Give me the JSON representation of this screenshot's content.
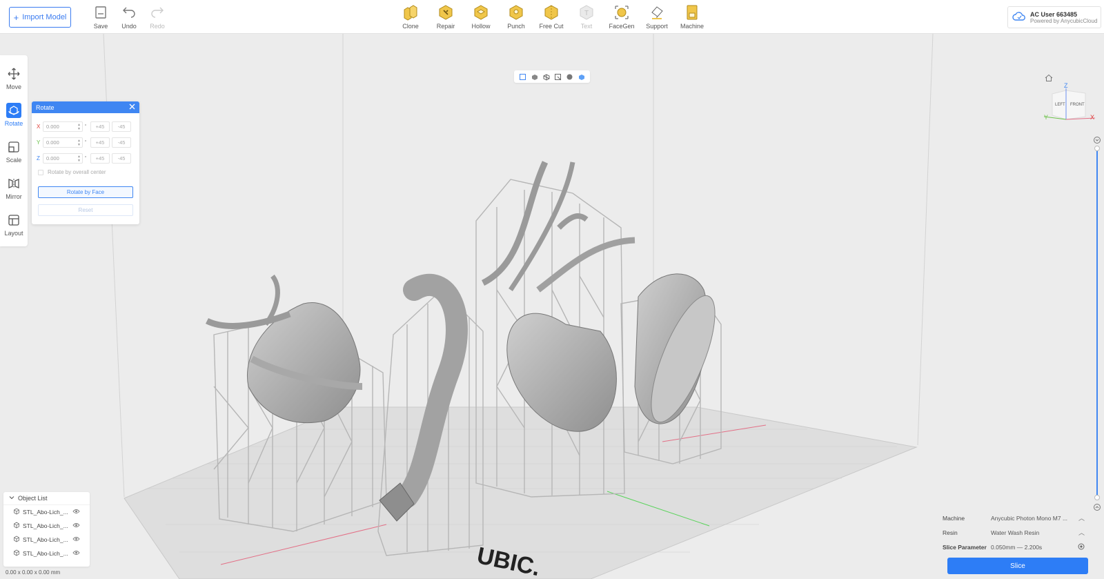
{
  "toolbar": {
    "import_label": "Import Model",
    "file_tools": [
      {
        "label": "Save",
        "icon": "save-icon"
      },
      {
        "label": "Undo",
        "icon": "undo-icon"
      },
      {
        "label": "Redo",
        "icon": "redo-icon",
        "disabled": true
      }
    ],
    "model_tools": [
      {
        "label": "Clone",
        "icon": "clone-icon"
      },
      {
        "label": "Repair",
        "icon": "repair-icon"
      },
      {
        "label": "Hollow",
        "icon": "hollow-icon"
      },
      {
        "label": "Punch",
        "icon": "punch-icon"
      },
      {
        "label": "Free Cut",
        "icon": "free-cut-icon"
      },
      {
        "label": "Text",
        "icon": "text-icon",
        "disabled": true
      },
      {
        "label": "FaceGen",
        "icon": "facegen-icon"
      },
      {
        "label": "Support",
        "icon": "support-icon"
      },
      {
        "label": "Machine",
        "icon": "machine-icon"
      }
    ],
    "accent_color": "#e8b526"
  },
  "user": {
    "name": "AC User 663485",
    "powered_by": "Powered by AnycubicCloud"
  },
  "sidebar": {
    "items": [
      {
        "label": "Move",
        "icon": "move-icon"
      },
      {
        "label": "Rotate",
        "icon": "rotate-icon",
        "active": true
      },
      {
        "label": "Scale",
        "icon": "scale-icon"
      },
      {
        "label": "Mirror",
        "icon": "mirror-icon"
      },
      {
        "label": "Layout",
        "icon": "layout-icon"
      }
    ]
  },
  "rotate_panel": {
    "title": "Rotate",
    "axes": [
      {
        "axis": "X",
        "value": "0.000",
        "color": "#e0403a",
        "plus": "+45",
        "minus": "-45"
      },
      {
        "axis": "Y",
        "value": "0.000",
        "color": "#6cc24a",
        "plus": "+45",
        "minus": "-45"
      },
      {
        "axis": "Z",
        "value": "0.000",
        "color": "#3f86f2",
        "plus": "+45",
        "minus": "-45"
      }
    ],
    "degree_symbol": "°",
    "checkbox_label": "Rotate by overall center",
    "rotate_by_face_label": "Rotate by Face",
    "reset_label": "Reset"
  },
  "viewcube": {
    "z": "Z",
    "y": "Y",
    "x": "X",
    "left": "LEFT",
    "front": "FRONT"
  },
  "object_list": {
    "title": "Object List",
    "items": [
      "STL_Abo-Lich_...",
      "STL_Abo-Lich_...",
      "STL_Abo-Lich_...",
      "STL_Abo-Lich_..."
    ]
  },
  "dimensions": "0.00 x 0.00 x 0.00 mm",
  "plate_text": "UBIC.",
  "params": {
    "machine_label": "Machine",
    "machine_value": "Anycubic Photon Mono M7 ...",
    "resin_label": "Resin",
    "resin_value": "Water Wash Resin",
    "slice_label": "Slice Parameter",
    "slice_value": "0.050mm — 2.200s"
  },
  "slice_button": "Slice",
  "colors": {
    "primary": "#2d7df6",
    "x_axis": "#e0403a",
    "y_axis": "#6cc24a",
    "z_axis": "#3f86f2"
  }
}
